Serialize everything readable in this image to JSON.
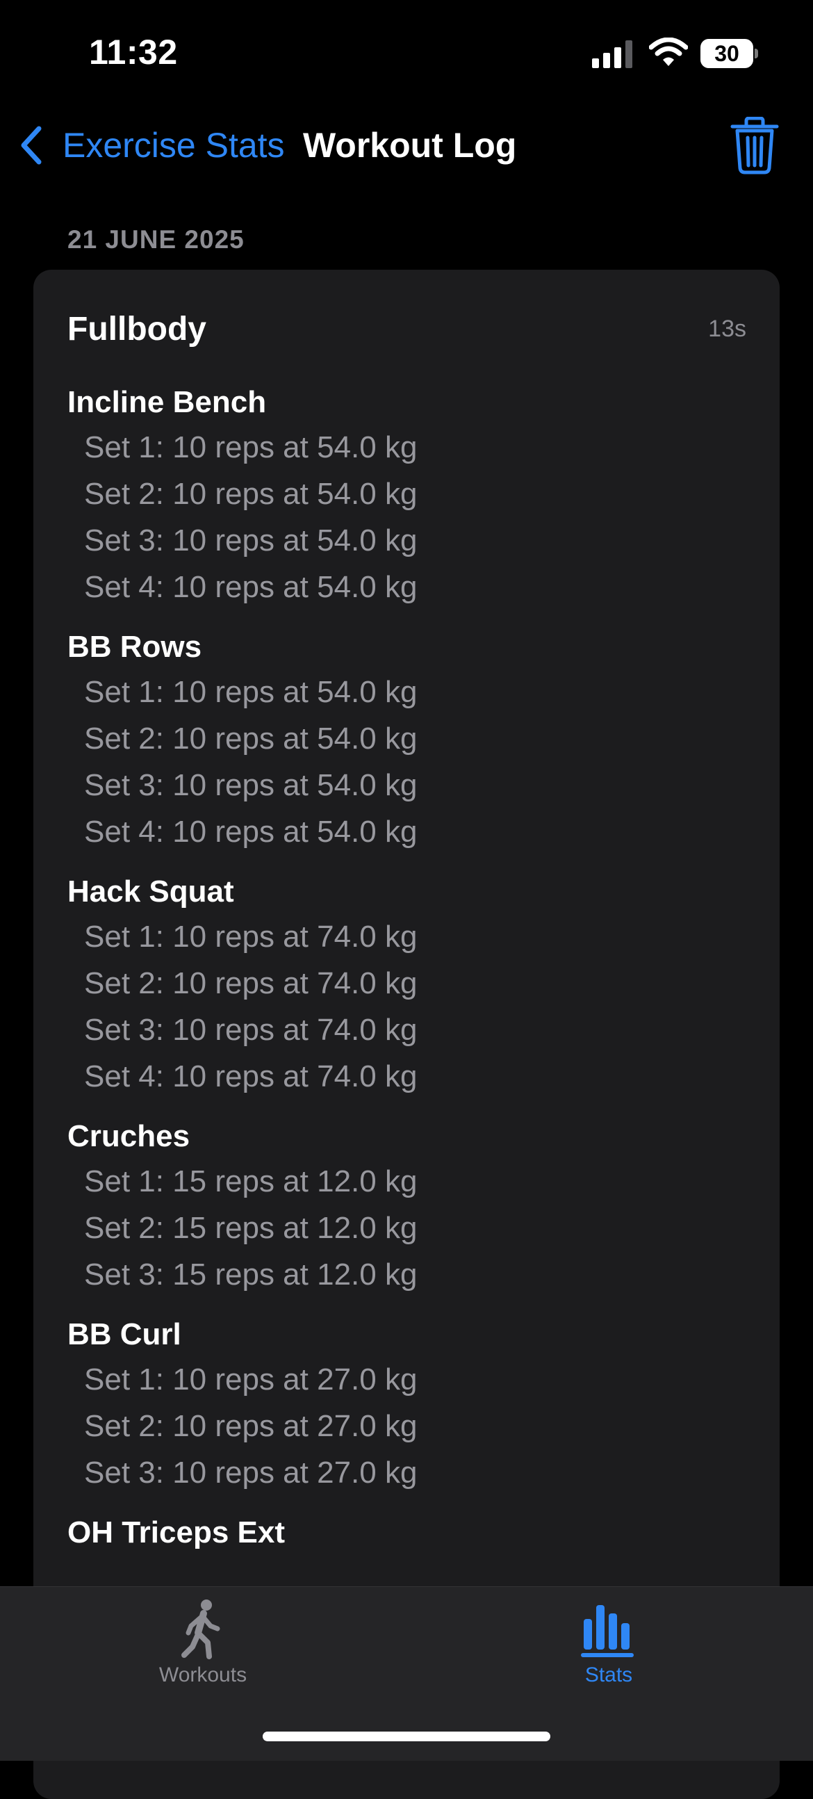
{
  "status_bar": {
    "time": "11:32",
    "battery": "30"
  },
  "nav": {
    "back_label": "Exercise Stats",
    "title": "Workout Log"
  },
  "section": {
    "date": "21 JUNE 2025"
  },
  "workout": {
    "name": "Fullbody",
    "duration": "13s",
    "exercises": [
      {
        "name": "Incline Bench",
        "sets": [
          "Set 1:  10 reps at 54.0 kg",
          "Set 2:  10 reps at 54.0 kg",
          "Set 3:  10 reps at 54.0 kg",
          "Set 4:  10 reps at 54.0 kg"
        ]
      },
      {
        "name": "BB Rows",
        "sets": [
          "Set 1:  10 reps at 54.0 kg",
          "Set 2:  10 reps at 54.0 kg",
          "Set 3:  10 reps at 54.0 kg",
          "Set 4:  10 reps at 54.0 kg"
        ]
      },
      {
        "name": "Hack Squat",
        "sets": [
          "Set 1:  10 reps at 74.0 kg",
          "Set 2:  10 reps at 74.0 kg",
          "Set 3:  10 reps at 74.0 kg",
          "Set 4:  10 reps at 74.0 kg"
        ]
      },
      {
        "name": "Cruches",
        "sets": [
          "Set 1:  15 reps at 12.0 kg",
          "Set 2:  15 reps at 12.0 kg",
          "Set 3:  15 reps at 12.0 kg"
        ]
      },
      {
        "name": "BB Curl",
        "sets": [
          "Set 1:  10 reps at 27.0 kg",
          "Set 2:  10 reps at 27.0 kg",
          "Set 3:  10 reps at 27.0 kg"
        ]
      },
      {
        "name": "OH Triceps Ext",
        "sets": []
      }
    ]
  },
  "tab_bar": {
    "tabs": [
      {
        "label": "Workouts",
        "icon": "walking-figure-icon",
        "selected": false
      },
      {
        "label": "Stats",
        "icon": "bar-chart-icon",
        "selected": true
      }
    ]
  },
  "colors": {
    "accent": "#2f87f5",
    "background": "#000000",
    "card": "#1c1c1e",
    "secondary_text": "#98989e",
    "tab_bar": "#252527"
  }
}
